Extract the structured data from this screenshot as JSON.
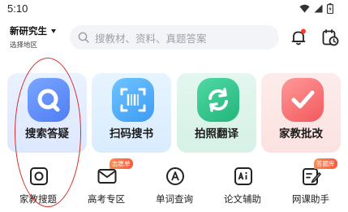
{
  "status_bar": {
    "time": "5:10"
  },
  "header": {
    "grade": "新研究生",
    "region": "选择地区",
    "search_placeholder": "搜教材、资料、真题答案"
  },
  "cards": [
    {
      "label": "搜索答疑",
      "icon": "magnifier-icon",
      "color": "#5b86f7"
    },
    {
      "label": "扫码搜书",
      "icon": "scan-icon",
      "color": "#4aa8f6"
    },
    {
      "label": "拍照翻译",
      "icon": "translate-icon",
      "color": "#2fc187"
    },
    {
      "label": "家教批改",
      "icon": "checkmark-icon",
      "color": "#f56a6d"
    }
  ],
  "tools": [
    {
      "label": "家教搜题",
      "icon": "camera-icon",
      "badge": ""
    },
    {
      "label": "高考专区",
      "icon": "envelope-icon",
      "badge": "志愿单"
    },
    {
      "label": "单词查询",
      "icon": "letter-a-icon",
      "badge": ""
    },
    {
      "label": "论文辅助",
      "icon": "ai-icon",
      "badge": ""
    },
    {
      "label": "网课助手",
      "icon": "edit-icon",
      "badge": "答题库"
    }
  ],
  "colors": {
    "annotation": "#d42b2b",
    "badge": "#ff6a3d",
    "notification_dot": "#ff3b30"
  }
}
